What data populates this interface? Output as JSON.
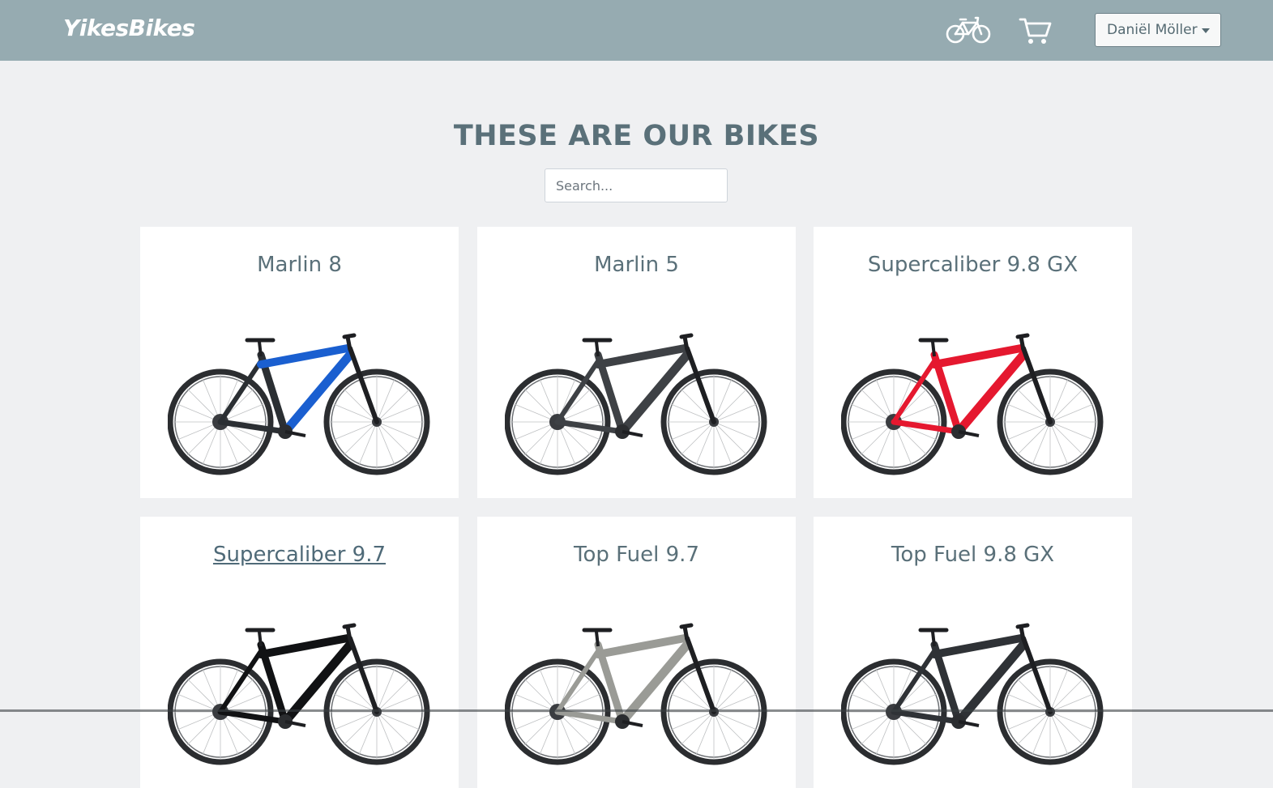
{
  "navbar": {
    "brand": "YikesBikes",
    "bike_icon": "bicycle-icon",
    "cart_icon": "cart-icon",
    "user_name": "Daniël Möller"
  },
  "main": {
    "title": "THESE ARE OUR BIKES",
    "search_placeholder": "Search..."
  },
  "bikes": [
    {
      "name": "Marlin 8",
      "frame_color": "#1a5fd0",
      "frame_color2": "#2b2f33"
    },
    {
      "name": "Marlin 5",
      "frame_color": "#3e4145",
      "frame_color2": "#3e4145"
    },
    {
      "name": "Supercaliber 9.8 GX",
      "frame_color": "#e5182f",
      "frame_color2": "#e5182f"
    },
    {
      "name": "Supercaliber 9.7",
      "frame_color": "#111214",
      "frame_color2": "#111214"
    },
    {
      "name": "Top Fuel 9.7",
      "frame_color": "#9a9b96",
      "frame_color2": "#9a9b96"
    },
    {
      "name": "Top Fuel 9.8 GX",
      "frame_color": "#2f3236",
      "frame_color2": "#2f3236"
    }
  ],
  "colors": {
    "navbar": "#96abb1",
    "background": "#eff0f2",
    "heading": "#5a7079"
  }
}
